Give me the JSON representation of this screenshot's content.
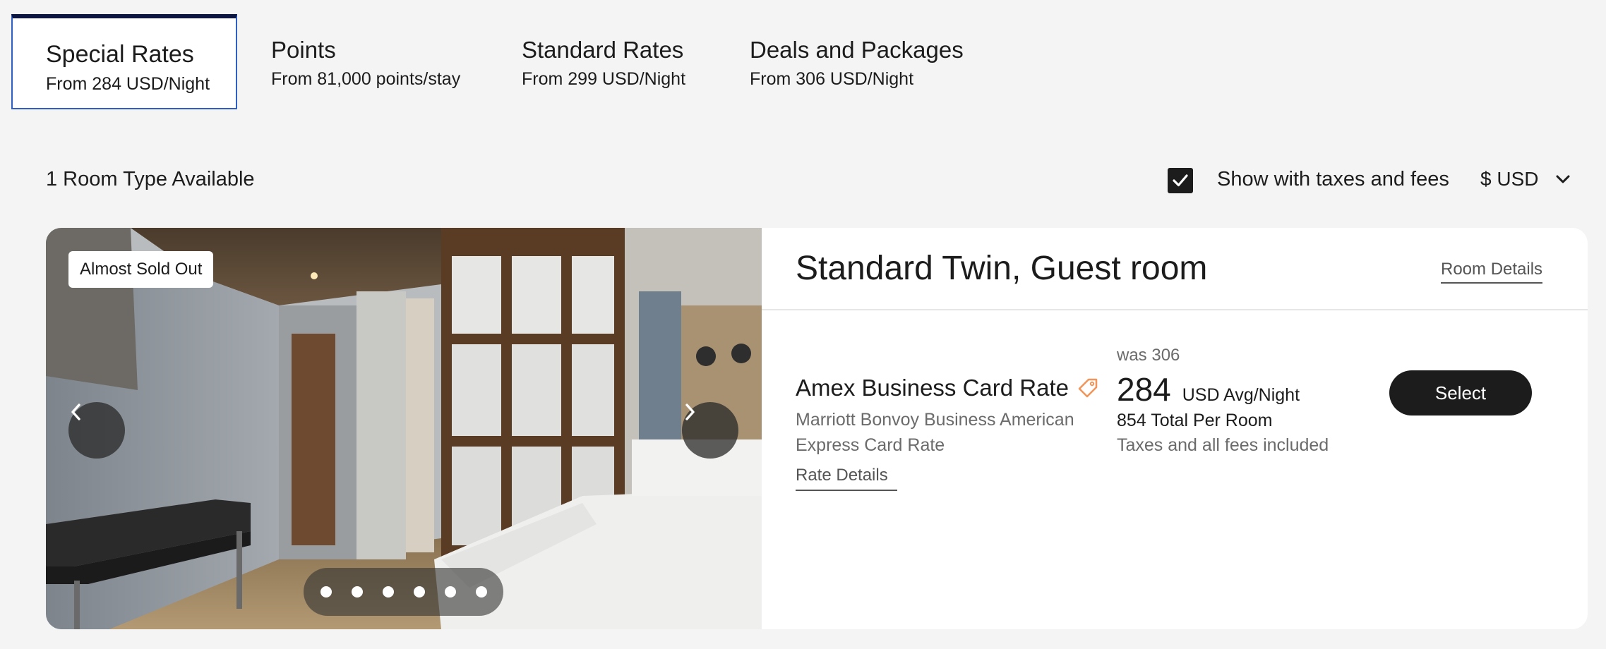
{
  "tabs": [
    {
      "title": "Special Rates",
      "subtitle": "From 284 USD/Night",
      "active": true
    },
    {
      "title": "Points",
      "subtitle": "From 81,000 points/stay",
      "active": false
    },
    {
      "title": "Standard Rates",
      "subtitle": "From 299 USD/Night",
      "active": false
    },
    {
      "title": "Deals and Packages",
      "subtitle": "From 306 USD/Night",
      "active": false
    }
  ],
  "summary": {
    "rooms_available": "1 Room Type Available",
    "tax_toggle_label": "Show with taxes and fees",
    "tax_toggle_checked": true,
    "currency": "$ USD"
  },
  "room": {
    "badge": "Almost Sold Out",
    "title": "Standard Twin, Guest room",
    "details_link": "Room Details",
    "photo_count": 6,
    "active_photo_index": 0
  },
  "rate": {
    "name": "Amex Business Card Rate",
    "description": "Marriott Bonvoy Business American Express Card Rate",
    "details_link": "Rate Details",
    "was_price": "was 306",
    "price": "284",
    "price_unit": "USD Avg/Night",
    "total": "854 Total Per Room",
    "taxes_note": "Taxes and all fees included",
    "select_label": "Select"
  },
  "colors": {
    "accent_border": "#2f5ec4",
    "tab_top_bar": "#0d1640",
    "button_dark": "#1c1c1c",
    "tag_icon": "#f0965a"
  }
}
